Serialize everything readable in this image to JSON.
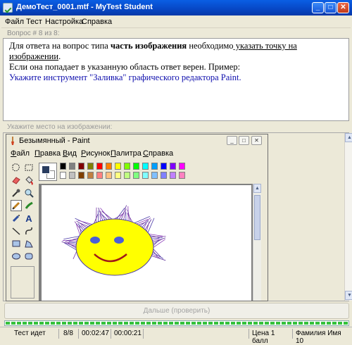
{
  "window": {
    "title": "ДемоТест_0001.mtf - MyTest Student",
    "icon": "check-icon"
  },
  "menu": [
    "Файл",
    "Тест",
    "Настройка",
    "Справка"
  ],
  "question": {
    "header": "Вопрос # 8 из 8:",
    "line1_pre": "Для ответа на вопрос типа ",
    "line1_bold": "часть изображения",
    "line1_mid": " необходимо",
    "line1_underlined": " указать точку на изображении",
    "line1_post": ".",
    "line2": "Если она попадает в указанную область ответ верен. Пример:",
    "task": "Укажите инструмент \"Заливка\" графического редактора Paint."
  },
  "image_header": "Укажите место на изображении:",
  "paint": {
    "title": "Безымянный - Paint",
    "menu": [
      {
        "u": "Ф",
        "rest": "айл"
      },
      {
        "u": "П",
        "rest": "равка"
      },
      {
        "u": "В",
        "rest": "ид"
      },
      {
        "u": "Р",
        "rest": "исунок"
      },
      {
        "u": "П",
        "rest": "алитра"
      },
      {
        "u": "С",
        "rest": "правка"
      }
    ],
    "tools": [
      "free-select-icon",
      "rect-select-icon",
      "eraser-icon",
      "fill-bucket-icon",
      "color-picker-icon",
      "magnifier-icon",
      "pencil-icon",
      "brush-icon",
      "airbrush-icon",
      "text-icon",
      "line-icon",
      "curve-icon",
      "rectangle-icon",
      "polygon-icon",
      "ellipse-icon",
      "rounded-rect-icon"
    ],
    "selected_tool": "pencil-icon",
    "palette_top": [
      "#000000",
      "#808080",
      "#800000",
      "#808000",
      "#008000",
      "#008080",
      "#000080",
      "#800080",
      "#808040",
      "#004040",
      "#0080ff",
      "#004080",
      "#8000ff",
      "#804000"
    ],
    "palette_top_real": [
      "#000000",
      "#808080",
      "#800000",
      "#808000",
      "#ff0000",
      "#ff8000",
      "#ffff00",
      "#80ff00",
      "#00ff00",
      "#00ffff",
      "#00a0ff",
      "#0000ff",
      "#8000ff",
      "#ff00ff"
    ],
    "palette_bottom": [
      "#ffffff",
      "#c0c0c0",
      "#804000",
      "#c08040",
      "#ff8080",
      "#ffc080",
      "#ffff80",
      "#c0ff80",
      "#80ff80",
      "#80ffff",
      "#80c0ff",
      "#8080ff",
      "#c080ff",
      "#ff80c0"
    ],
    "fill_color": "#ffff00",
    "face_outline": "#4a3aa8"
  },
  "next_button": "Дальше (проверить)",
  "progress": 1.0,
  "status": {
    "state": "Тест идет",
    "count": "8/8",
    "time1": "00:02:47",
    "time2": "00:00:21",
    "price": "Цена 1 балл",
    "name": "Фамилия Имя 10"
  }
}
